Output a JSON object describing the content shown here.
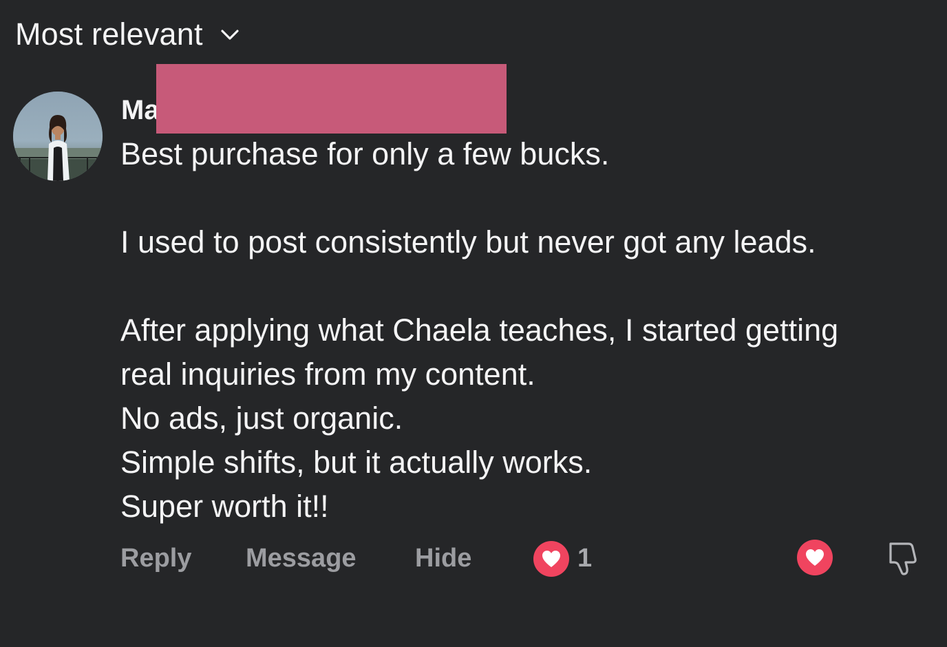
{
  "sort": {
    "label": "Most relevant",
    "icon": "chevron-down-icon"
  },
  "comment": {
    "author_name_visible": "Ma",
    "lines_block_1": [
      "Best purchase for only a few bucks."
    ],
    "lines_block_2": [
      "I used to post consistently but never got any leads."
    ],
    "lines_block_3": [
      "After applying what Chaela teaches, I started getting",
      "real inquiries from my content.",
      "No ads, just organic.",
      "Simple shifts, but it actually works.",
      "Super worth it!!"
    ]
  },
  "actions": {
    "reply": "Reply",
    "message": "Message",
    "hide": "Hide",
    "reaction_count": "1"
  },
  "colors": {
    "background": "#252628",
    "text": "#f4f4f5",
    "muted": "#9c9da1",
    "heart": "#f0445f",
    "redaction": "#c75a79"
  },
  "icons": [
    "chevron-down-icon",
    "heart-icon",
    "thumbs-down-icon"
  ]
}
